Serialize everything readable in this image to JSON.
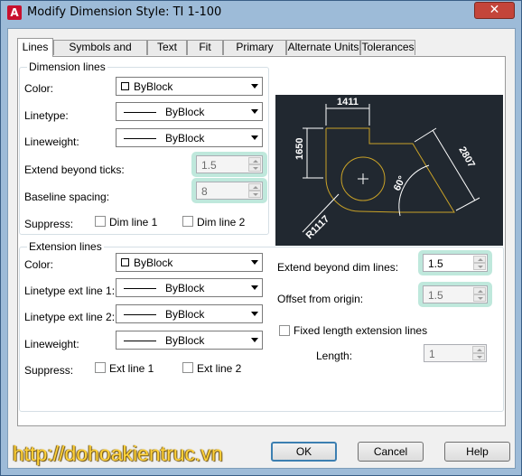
{
  "window": {
    "title": "Modify Dimension Style: TI 1-100",
    "app_icon_letter": "A",
    "close_label": "✕"
  },
  "tabs": [
    {
      "label": "Lines",
      "active": true
    },
    {
      "label": "Symbols and Arrows"
    },
    {
      "label": "Text"
    },
    {
      "label": "Fit"
    },
    {
      "label": "Primary Units"
    },
    {
      "label": "Alternate Units"
    },
    {
      "label": "Tolerances"
    }
  ],
  "dimension_lines": {
    "title": "Dimension lines",
    "color_label": "Color:",
    "color_value": "ByBlock",
    "linetype_label": "Linetype:",
    "linetype_value": "ByBlock",
    "lineweight_label": "Lineweight:",
    "lineweight_value": "ByBlock",
    "extend_label": "Extend beyond ticks:",
    "extend_value": "1.5",
    "baseline_label": "Baseline spacing:",
    "baseline_value": "8",
    "suppress_label": "Suppress:",
    "dim_line1": "Dim line 1",
    "dim_line2": "Dim line 2"
  },
  "extension_lines": {
    "title": "Extension lines",
    "color_label": "Color:",
    "color_value": "ByBlock",
    "linetype1_label": "Linetype ext line 1:",
    "linetype1_value": "ByBlock",
    "linetype2_label": "Linetype ext line 2:",
    "linetype2_value": "ByBlock",
    "lineweight_label": "Lineweight:",
    "lineweight_value": "ByBlock",
    "suppress_label": "Suppress:",
    "ext_line1": "Ext line 1",
    "ext_line2": "Ext line 2",
    "extend_dim_label": "Extend beyond dim lines:",
    "extend_dim_value": "1.5",
    "offset_label": "Offset from origin:",
    "offset_value": "1.5",
    "fixed_length_label": "Fixed length extension lines",
    "length_label": "Length:",
    "length_value": "1"
  },
  "preview": {
    "dim_top": "1411",
    "dim_left": "1650",
    "dim_right": "2807",
    "dim_angle": "60°",
    "dim_radius": "R1117",
    "bg_color": "#212830",
    "geometry_color": "#c9a227",
    "dim_color": "#ffffff"
  },
  "buttons": {
    "ok": "OK",
    "cancel": "Cancel",
    "help": "Help"
  },
  "watermark": "http://dohoakientruc.vn",
  "colors": {
    "highlight": "#bfe8dc",
    "window_frame": "#9dbbd8",
    "close_button": "#c4453a",
    "watermark": "#ffd23a"
  }
}
